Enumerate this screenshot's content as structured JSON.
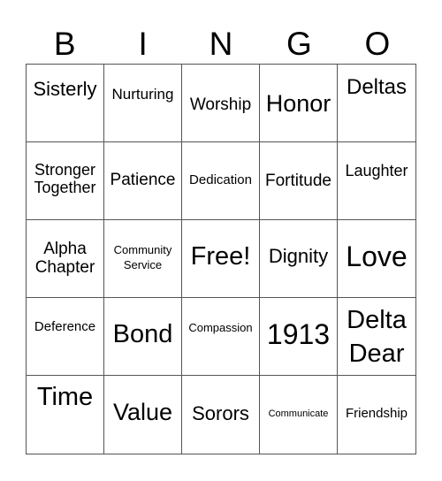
{
  "header": {
    "letters": [
      "B",
      "I",
      "N",
      "G",
      "O"
    ]
  },
  "cells": [
    "Sisterly",
    "Nurturing",
    "Worship",
    "Honor",
    "Deltas",
    "Stronger\nTogether",
    "Patience",
    "Dedication",
    "Fortitude",
    "Laughter",
    "Alpha\nChapter",
    "Community\nService",
    "Free!",
    "Dignity",
    "Love",
    "Deference",
    "Bond",
    "Compassion",
    "1913",
    "Delta\nDear",
    "Time",
    "Value",
    "Sorors",
    "Communicate",
    "Friendship"
  ]
}
